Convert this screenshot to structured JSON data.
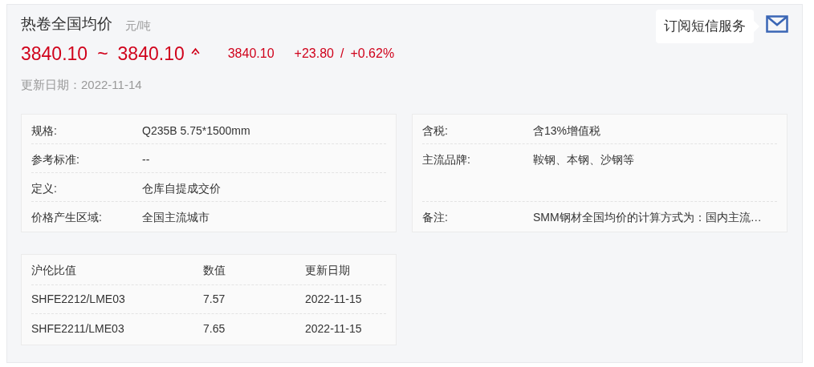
{
  "header": {
    "title": "热卷全国均价",
    "unit": "元/吨",
    "price_low": "3840.10",
    "separator": "~",
    "price_high": "3840.10",
    "average": "3840.10",
    "change": "+23.80",
    "change_separator": "/",
    "change_percent": "+0.62%",
    "update_date": "更新日期：2022-11-14"
  },
  "subscribe": {
    "tooltip": "订阅短信服务"
  },
  "spec_left": [
    {
      "label": "规格:",
      "value": "Q235B 5.75*1500mm"
    },
    {
      "label": "参考标准:",
      "value": "--"
    },
    {
      "label": "定义:",
      "value": "仓库自提成交价"
    },
    {
      "label": "价格产生区域:",
      "value": "全国主流城市"
    }
  ],
  "spec_right": [
    {
      "label": "含税:",
      "value": "含13%增值税"
    },
    {
      "label": "主流品牌:",
      "value": "鞍钢、本钢、沙钢等",
      "tall": true
    },
    {
      "label": "备注:",
      "value": "SMM钢材全国均价的计算方式为：国内主流…"
    }
  ],
  "ratio_table": {
    "columns": [
      "沪伦比值",
      "数值",
      "更新日期"
    ],
    "rows": [
      [
        "SHFE2212/LME03",
        "7.57",
        "2022-11-15"
      ],
      [
        "SHFE2211/LME03",
        "7.65",
        "2022-11-15"
      ]
    ]
  }
}
